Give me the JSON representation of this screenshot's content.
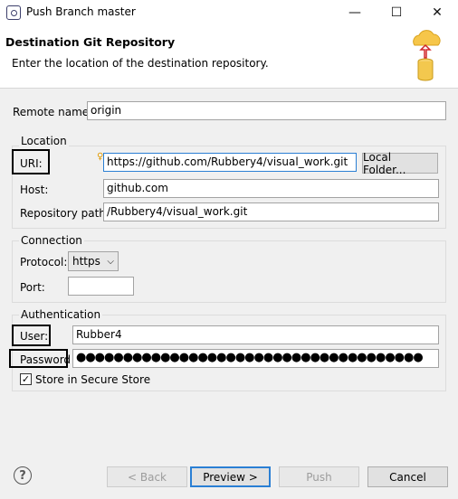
{
  "window": {
    "title": "Push Branch master",
    "controls": {
      "minimize": "—",
      "maximize": "☐",
      "close": "✕"
    }
  },
  "banner": {
    "title": "Destination Git Repository",
    "description": "Enter the location of the destination repository.",
    "icon": "cloud-repository-icon"
  },
  "remote": {
    "label": "Remote name:",
    "value": "origin"
  },
  "location": {
    "group_label": "Location",
    "uri": {
      "label": "URI:",
      "value": "https://github.com/Rubbery4/visual_work.git"
    },
    "local_folder_button": "Local Folder...",
    "host": {
      "label": "Host:",
      "value": "github.com"
    },
    "repo_path": {
      "label": "Repository path:",
      "value": "/Rubbery4/visual_work.git"
    }
  },
  "connection": {
    "group_label": "Connection",
    "protocol": {
      "label": "Protocol:",
      "value": "https"
    },
    "port": {
      "label": "Port:",
      "value": ""
    }
  },
  "authentication": {
    "group_label": "Authentication",
    "user": {
      "label": "User:",
      "value": "Rubber4"
    },
    "password": {
      "label": "Password",
      "value": "●●●●●●●●●●●●●●●●●●●●●●●●●●●●●●●●●●●●●"
    },
    "store": {
      "label": "Store in Secure Store",
      "checked": true
    }
  },
  "footer": {
    "back": "< Back",
    "preview": "Preview >",
    "push": "Push",
    "cancel": "Cancel"
  },
  "colors": {
    "focus": "#2a7fd4",
    "window_bg": "#f0f0f0"
  }
}
